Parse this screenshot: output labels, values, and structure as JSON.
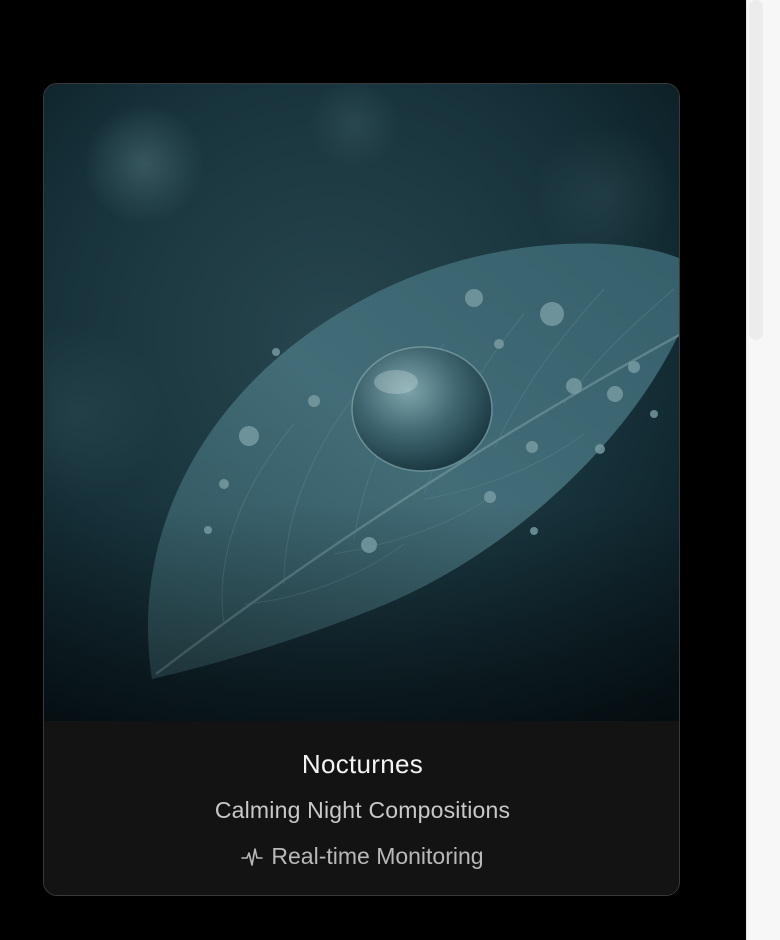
{
  "card": {
    "title": "Nocturnes",
    "subtitle": "Calming Night Compositions",
    "status": {
      "icon": "pulse-icon",
      "label": "Real-time Monitoring"
    },
    "image": {
      "description_icon": "leaf-water-drop-image"
    }
  },
  "colors": {
    "background": "#000000",
    "card_background": "#131313",
    "card_border": "#3a3a3a",
    "title": "#f4f4f4",
    "subtitle": "#c9c9c9",
    "status": "#b9b9b9",
    "image_base": "#0c2028",
    "leaf": "#3d6470"
  }
}
